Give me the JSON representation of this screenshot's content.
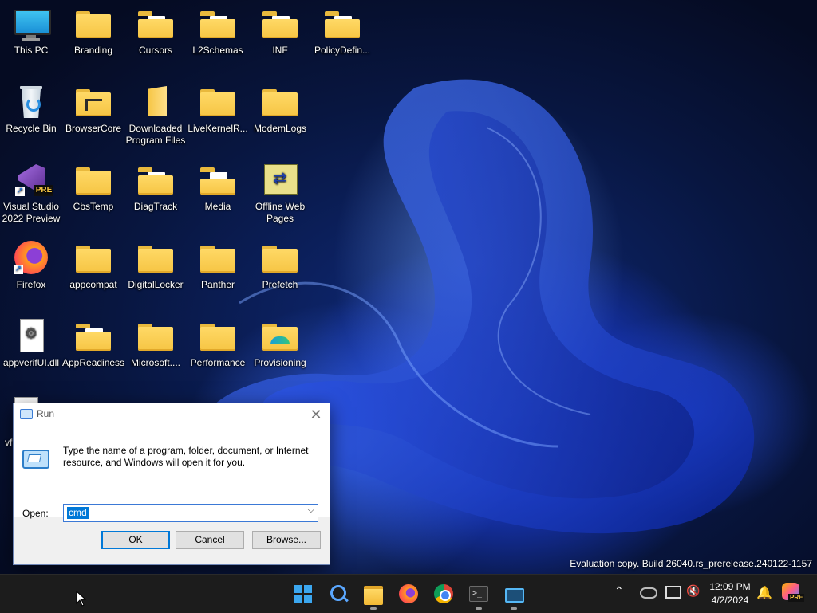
{
  "desktop": {
    "icons": [
      {
        "label": "This PC",
        "icon": "monitor-icon"
      },
      {
        "label": "Branding",
        "icon": "folder-icon"
      },
      {
        "label": "Cursors",
        "icon": "folder-icon"
      },
      {
        "label": "L2Schemas",
        "icon": "folder-icon"
      },
      {
        "label": "INF",
        "icon": "folder-icon"
      },
      {
        "label": "PolicyDefin...",
        "icon": "folder-icon"
      },
      {
        "label": "Recycle Bin",
        "icon": "recycle-bin-icon"
      },
      {
        "label": "BrowserCore",
        "icon": "folder-icon"
      },
      {
        "label": "Downloaded Program Files",
        "icon": "folder-icon"
      },
      {
        "label": "LiveKernelR...",
        "icon": "folder-icon"
      },
      {
        "label": "ModemLogs",
        "icon": "folder-icon"
      },
      {
        "label": "Visual Studio 2022 Preview",
        "icon": "visual-studio-icon",
        "badge": "PRE"
      },
      {
        "label": "CbsTemp",
        "icon": "folder-icon"
      },
      {
        "label": "DiagTrack",
        "icon": "folder-icon"
      },
      {
        "label": "Media",
        "icon": "folder-icon"
      },
      {
        "label": "Offline Web Pages",
        "icon": "offline-web-pages-icon"
      },
      {
        "label": "Firefox",
        "icon": "firefox-icon"
      },
      {
        "label": "appcompat",
        "icon": "folder-icon"
      },
      {
        "label": "DigitalLocker",
        "icon": "folder-icon"
      },
      {
        "label": "Panther",
        "icon": "folder-icon"
      },
      {
        "label": "Prefetch",
        "icon": "folder-icon"
      },
      {
        "label": "appverifUI.dll",
        "icon": "dll-file-icon"
      },
      {
        "label": "AppReadiness",
        "icon": "folder-icon"
      },
      {
        "label": "Microsoft....",
        "icon": "folder-icon"
      },
      {
        "label": "Performance",
        "icon": "folder-icon"
      },
      {
        "label": "Provisioning",
        "icon": "folder-icon"
      },
      {
        "label": "vf",
        "icon": "file-icon"
      }
    ]
  },
  "run_dialog": {
    "title": "Run",
    "description": "Type the name of a program, folder, document, or Internet resource, and Windows will open it for you.",
    "open_label": "Open:",
    "open_value": "cmd",
    "ok_label": "OK",
    "cancel_label": "Cancel",
    "browse_label": "Browse..."
  },
  "watermark": "Evaluation copy. Build 26040.rs_prerelease.240122-1157",
  "taskbar": {
    "apps": [
      "start-icon",
      "search-icon",
      "file-explorer-icon",
      "firefox-icon",
      "chrome-icon",
      "terminal-icon",
      "run-icon"
    ],
    "clock_time": "12:09 PM",
    "clock_date": "4/2/2024",
    "copilot_badge": "PRE"
  }
}
